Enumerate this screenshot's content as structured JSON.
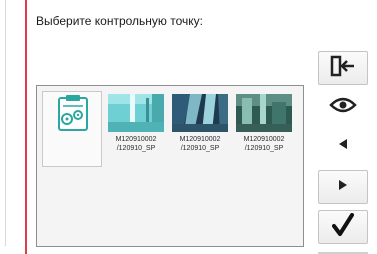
{
  "prompt": "Выберите контрольную точку:",
  "items": [
    {
      "icon": "settings-document-icon",
      "line1": "",
      "line2": ""
    },
    {
      "icon": "camera-snapshot-1",
      "line1": "M120910002",
      "line2": "/120910_SP"
    },
    {
      "icon": "camera-snapshot-2",
      "line1": "M120910002",
      "line2": "/120910_SP"
    },
    {
      "icon": "camera-snapshot-3",
      "line1": "M120910002",
      "line2": "/120910_SP"
    }
  ],
  "buttons": [
    "exit-icon",
    "eye-icon",
    "triangle-left-icon",
    "triangle-right-icon",
    "checkmark-icon"
  ],
  "colors": {
    "accent": "#e23a4a",
    "icon_teal": "#2aa8a0"
  }
}
